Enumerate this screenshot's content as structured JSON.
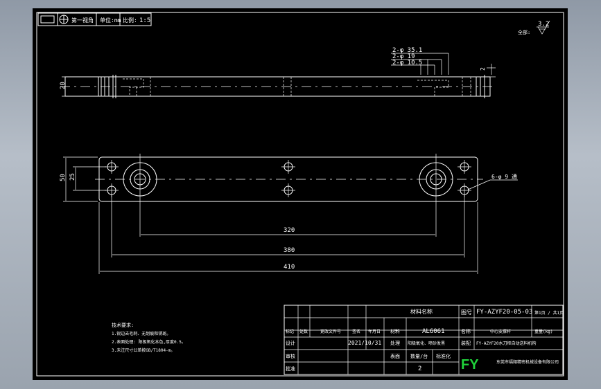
{
  "title_strip": {
    "projection_label": "第一视角",
    "unit_label": "单位:mm",
    "scale_label": "比例:",
    "scale_value": "1:5"
  },
  "surface_roughness": {
    "label": "全部:",
    "value": "3.2"
  },
  "dimensions": {
    "hole_35": "2-φ 35.1",
    "hole_19": "2-φ 19",
    "hole_10": "2-φ 10.5",
    "height_20": "20",
    "small_2": "2",
    "width_50": "50",
    "width_25": "25",
    "hole_9": "6-φ 9 通",
    "len_320": "320",
    "len_380": "380",
    "len_410": "410"
  },
  "tech_notes": {
    "title": "技术要求:",
    "line1": "1.锐边去毛刺、无划痕和锈斑。",
    "line2": "2.表面处理: 阳极氧化本色,厚度0.5。",
    "line3": "3.未注尺寸公差按GB/T1804-m。"
  },
  "title_block": {
    "material_header": "材料名称",
    "doc_no": "FY-AZYF20-05-03",
    "sheet_label": "第1页 / 共1页",
    "marker_label": "标记",
    "count_label": "处数",
    "change_label": "更改文件号",
    "sign_label": "签名",
    "date_header": "年月日",
    "material_label": "材料",
    "material_value": "AL6061",
    "part_name_label": "名称",
    "part_name_value": "中心支撑杆",
    "weight_label": "重量(kg)",
    "weight_value": "",
    "design_label": "设计",
    "design_date": "2021/10/31",
    "treatment_label": "处理",
    "treatment_value": "阳极氧化、喷砂发黑",
    "assembly_label": "装配",
    "assembly_value": "FY-AZYF20水刀柜自动送料机构",
    "review_label": "审核",
    "surface_label": "表面",
    "qty_label": "数量/台",
    "std_label": "标准化",
    "qty_value": "2",
    "approve_label": "批准",
    "logo": "FY",
    "company": "东莞市福翔精密机械设备有限公司"
  }
}
